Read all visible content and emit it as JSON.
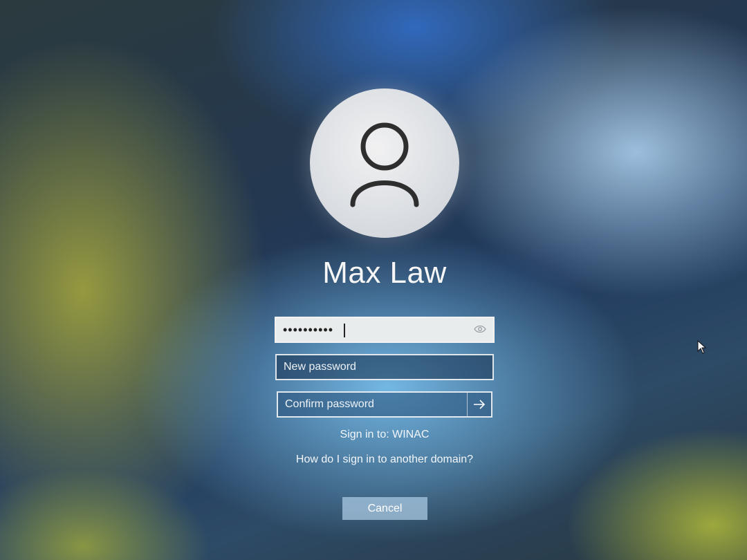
{
  "user": {
    "name": "Max Law",
    "avatar_icon": "user-silhouette-icon"
  },
  "current_password": {
    "masked_value": "••••••••••",
    "reveal_icon": "eye-icon"
  },
  "new_password": {
    "placeholder": "New password"
  },
  "confirm_password": {
    "placeholder": "Confirm password",
    "submit_icon": "arrow-right-icon"
  },
  "sign_in_to": "Sign in to: WINAC",
  "another_domain_link": "How do I sign in to another domain?",
  "cancel_label": "Cancel",
  "colors": {
    "field_border": "#ffffff",
    "cancel_bg": "#aac8e1",
    "text": "#f6f6f6"
  }
}
